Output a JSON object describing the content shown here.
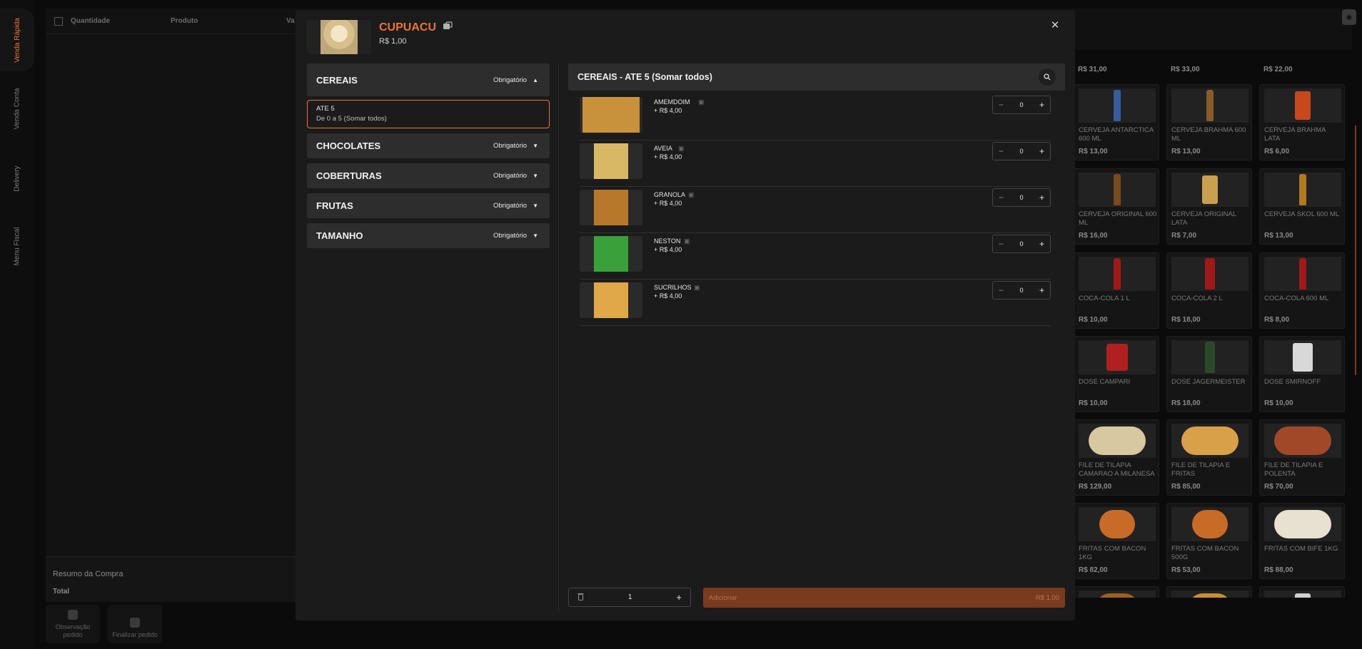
{
  "nav": {
    "items": [
      {
        "label": "Venda Rápida",
        "active": true
      },
      {
        "label": "Venda Conta",
        "active": false
      },
      {
        "label": "Delivery",
        "active": false
      },
      {
        "label": "Menu Fiscal",
        "active": false
      }
    ]
  },
  "order_table": {
    "columns": [
      "Quantidade",
      "Produto",
      "Va"
    ]
  },
  "summary": {
    "title": "Resumo da Compra",
    "total_label": "Total"
  },
  "actions": {
    "observation": "Observação pedido",
    "finalize": "Finalizar pedido"
  },
  "products": {
    "top_prices": [
      "R$ 31,00",
      "R$ 33,00",
      "R$ 22,00"
    ],
    "tiles": [
      {
        "name": "CERVEJA ANTARCTICA 600 ML",
        "price": "R$ 13,00"
      },
      {
        "name": "CERVEJA BRAHMA 600 ML",
        "price": "R$ 13,00"
      },
      {
        "name": "CERVEJA BRAHMA LATA",
        "price": "R$ 6,00"
      },
      {
        "name": "CERVEJA ORIGINAL 600 ML",
        "price": "R$ 16,00"
      },
      {
        "name": "CERVEJA ORIGINAL LATA",
        "price": "R$ 7,00"
      },
      {
        "name": "CERVEJA SKOL 600 ML",
        "price": "R$ 13,00"
      },
      {
        "name": "COCA-COLA 1 L",
        "price": "R$ 10,00"
      },
      {
        "name": "COCA-COLA 2 L",
        "price": "R$ 18,00"
      },
      {
        "name": "COCA-COLA 600 ML",
        "price": "R$ 8,00"
      },
      {
        "name": "DOSE CAMPARI",
        "price": "R$ 10,00"
      },
      {
        "name": "DOSE JAGERMEISTER",
        "price": "R$ 18,00"
      },
      {
        "name": "DOSE SMIRNOFF",
        "price": "R$ 10,00"
      },
      {
        "name": "FILE DE TILAPIA CAMARAO A MILANESA",
        "price": "R$ 129,00"
      },
      {
        "name": "FILE DE TILAPIA E FRITAS",
        "price": "R$ 85,00"
      },
      {
        "name": "FILE DE TILAPIA E POLENTA",
        "price": "R$ 70,00"
      },
      {
        "name": "FRITAS COM BACON 1KG",
        "price": "R$ 82,00"
      },
      {
        "name": "FRITAS COM BACON 500G",
        "price": "R$ 53,00"
      },
      {
        "name": "FRITAS COM BIFE 1KG",
        "price": "R$ 88,00"
      }
    ]
  },
  "modal": {
    "title": "CUPUACU",
    "price": "R$ 1,00",
    "groups": [
      {
        "name": "CEREAIS",
        "required": "Obrigatório",
        "expanded": true
      },
      {
        "name": "CHOCOLATES",
        "required": "Obrigatório",
        "expanded": false
      },
      {
        "name": "COBERTURAS",
        "required": "Obrigatório",
        "expanded": false
      },
      {
        "name": "FRUTAS",
        "required": "Obrigatório",
        "expanded": false
      },
      {
        "name": "TAMANHO",
        "required": "Obrigatório",
        "expanded": false
      }
    ],
    "suboption": {
      "title": "ATE 5",
      "rule": "De 0 a 5 (Somar todos)"
    },
    "section_title": "CEREAIS - ATE 5 (Somar todos)",
    "items": [
      {
        "name": "AMEMDOIM",
        "price": "+ R$ 4,00",
        "qty": "0",
        "color": "#c8923c"
      },
      {
        "name": "AVEIA",
        "price": "+ R$ 4,00",
        "qty": "0",
        "color": "#d8b864"
      },
      {
        "name": "GRANOLA",
        "price": "+ R$ 4,00",
        "qty": "0",
        "color": "#b8782c"
      },
      {
        "name": "NESTON",
        "price": "+ R$ 4,00",
        "qty": "0",
        "color": "#3aa03a"
      },
      {
        "name": "SUCRILHOS",
        "price": "+ R$ 4,00",
        "qty": "0",
        "color": "#e0a848"
      }
    ],
    "footer": {
      "quantity": "1",
      "add_label": "Adicionar",
      "add_total": "R$ 1,00"
    },
    "accent": "#e8743b"
  }
}
